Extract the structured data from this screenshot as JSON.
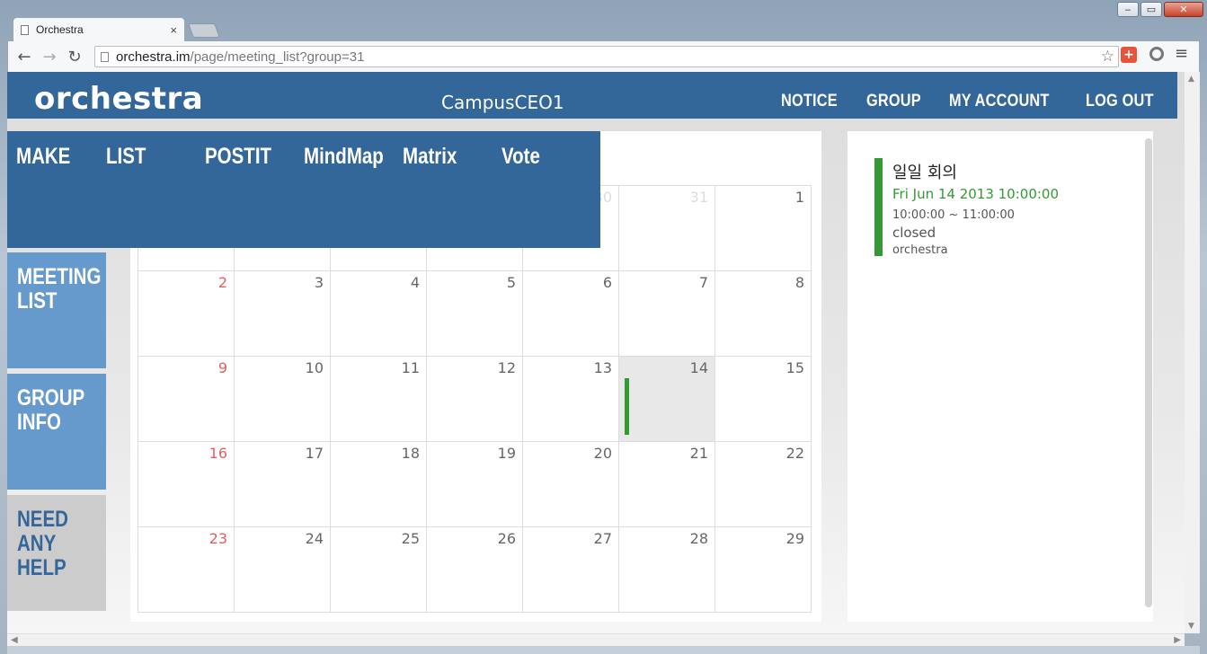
{
  "browser": {
    "tab_title": "Orchestra",
    "tab_close": "×",
    "url_host": "orchestra.im",
    "url_path": "/page/meeting_list?group=31",
    "window_controls": [
      "‒",
      "▭",
      "✕"
    ],
    "back_icon": "←",
    "forward_icon": "→",
    "reload_icon": "↻",
    "star_icon": "☆",
    "menu_icon": "≡",
    "extension_icon": "+"
  },
  "header": {
    "logo": "orchestra",
    "group_name": "CampusCEO1",
    "nav": [
      "NOTICE",
      "GROUP",
      "MY ACCOUNT",
      "LOG OUT"
    ]
  },
  "dropdown": {
    "items": [
      "MAKE",
      "LIST",
      "POSTIT",
      "MindMap",
      "Matrix",
      "Vote"
    ]
  },
  "sidebar": {
    "items": [
      {
        "label_line1": "MEETING",
        "label_line2": "LIST",
        "label_line3": ""
      },
      {
        "label_line1": "GROUP",
        "label_line2": "INFO",
        "label_line3": ""
      },
      {
        "label_line1": "NEED",
        "label_line2": "ANY",
        "label_line3": "HELP"
      }
    ]
  },
  "calendar": {
    "weeks": [
      [
        "",
        "",
        "",
        "",
        "30",
        "31",
        "1"
      ],
      [
        "2",
        "3",
        "4",
        "5",
        "6",
        "7",
        "8"
      ],
      [
        "9",
        "10",
        "11",
        "12",
        "13",
        "14",
        "15"
      ],
      [
        "16",
        "17",
        "18",
        "19",
        "20",
        "21",
        "22"
      ],
      [
        "23",
        "24",
        "25",
        "26",
        "27",
        "28",
        "29"
      ]
    ],
    "selected_day": "14"
  },
  "event": {
    "title": "일일 회의",
    "date": "Fri Jun 14 2013 10:00:00",
    "time": "10:00:00 ~ 11:00:00",
    "status": "closed",
    "owner": "orchestra"
  },
  "colors": {
    "brand": "#336699",
    "sidebar": "#6699cc",
    "help": "#cccccc",
    "event_green": "#339933",
    "sunday_red": "#e06060"
  },
  "icons": {
    "tab": "page-icon",
    "star": "star-icon",
    "reload": "reload-icon"
  }
}
